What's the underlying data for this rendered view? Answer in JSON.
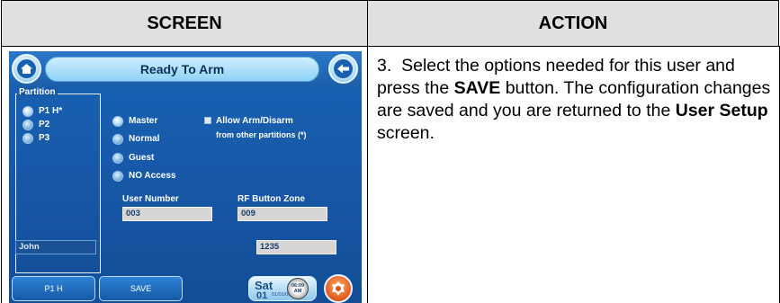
{
  "table": {
    "header_screen": "SCREEN",
    "header_action": "ACTION"
  },
  "action": {
    "step": "3.",
    "text_1": "Select the options needed for this user and press the ",
    "save_bold": "SAVE",
    "text_2": " button.  The configuration changes are saved and you are returned to the ",
    "user_setup_bold": "User Setup",
    "text_3": " screen."
  },
  "screen": {
    "title": "Ready To Arm",
    "partition_label": "Partition",
    "partitions": [
      "P1 H*",
      "P2",
      "P3"
    ],
    "user_types": [
      "Master",
      "Normal",
      "Guest",
      "NO Access"
    ],
    "allow_line1": "Allow Arm/Disarm",
    "allow_line2": "from other partitions (*)",
    "user_number_label": "User Number",
    "user_number_value": "003",
    "rf_zone_label": "RF Button Zone",
    "rf_zone_value": "009",
    "name_value": "John",
    "code_value": "1235",
    "btn_partition": "P1 H",
    "btn_save": "SAVE",
    "date_day": "Sat",
    "date_num": "01",
    "date_full": "01/01/00",
    "clock_time": "06:09",
    "clock_ampm": "AM"
  },
  "icons": [
    "home-icon",
    "back-arrow-icon",
    "clock-icon",
    "emergency-icon"
  ]
}
